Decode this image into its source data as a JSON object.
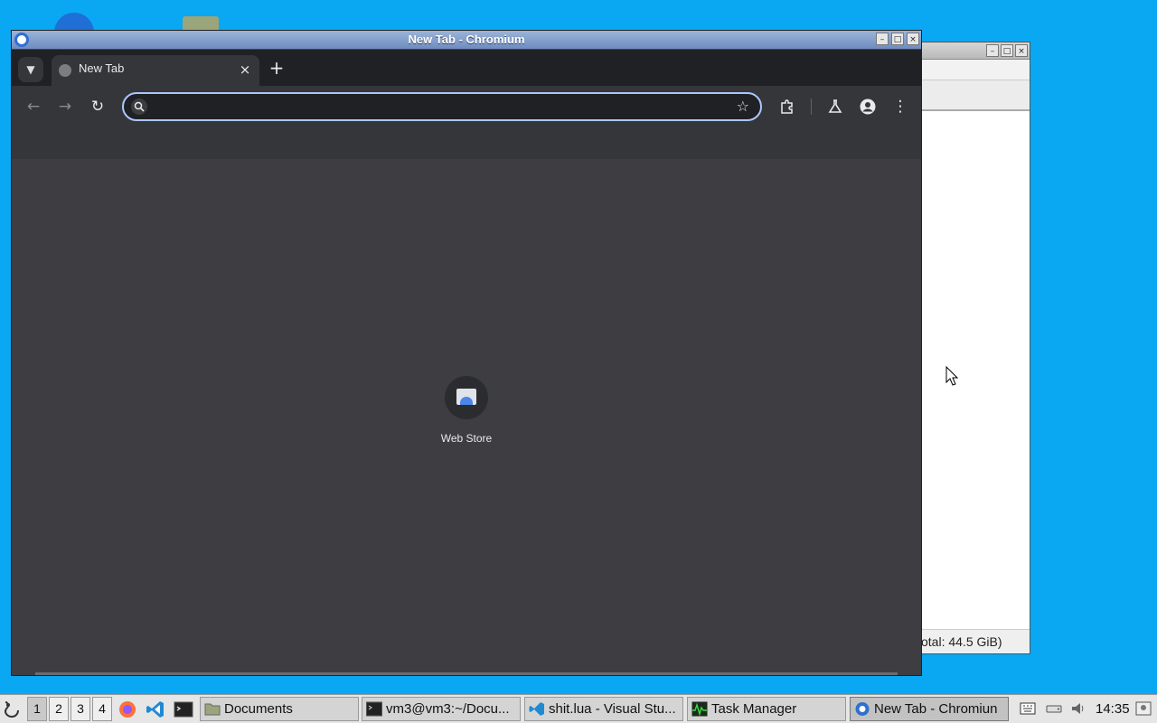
{
  "chromium_window": {
    "title": "New Tab - Chromium",
    "tab": {
      "label": "New Tab",
      "close": "×"
    },
    "new_tab": "+",
    "omnibox": {
      "value": "",
      "placeholder": ""
    },
    "shortcut": {
      "label": "Web Store"
    }
  },
  "back_window": {
    "status": "otal: 44.5 GiB)"
  },
  "taskbar": {
    "workspaces": [
      "1",
      "2",
      "3",
      "4"
    ],
    "active_workspace": "1",
    "tasks": [
      {
        "label": "Documents",
        "icon": "folder-icon"
      },
      {
        "label": "vm3@vm3:~/Docu...",
        "icon": "terminal-icon"
      },
      {
        "label": "shit.lua - Visual Stu...",
        "icon": "vscode-icon"
      },
      {
        "label": "Task Manager",
        "icon": "task-manager-icon"
      },
      {
        "label": "New Tab - Chromiun",
        "icon": "chromium-icon"
      }
    ],
    "clock": "14:35"
  },
  "colors": {
    "desktop": "#0aa7f2",
    "omnibox_focus": "#aac7ff",
    "window_content": "#3d3d42"
  }
}
